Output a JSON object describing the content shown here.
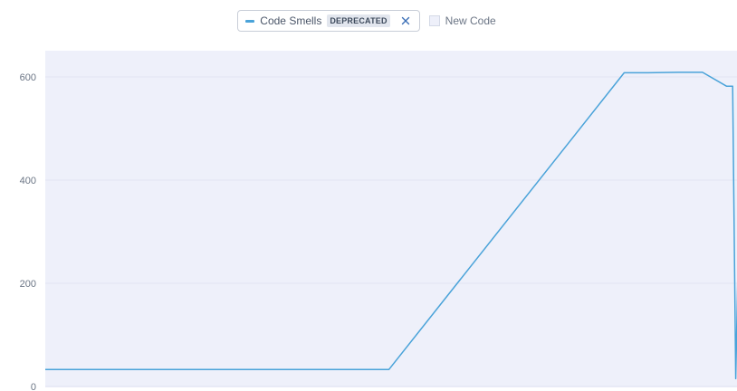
{
  "legend": {
    "series_label": "Code Smells",
    "badge": "DEPRECATED",
    "new_code_label": "New Code"
  },
  "colors": {
    "series_line": "#4aa3d9",
    "plot_background": "#eef0fa",
    "gridline": "#e2e5f2"
  },
  "chart_data": {
    "type": "line",
    "title": "",
    "xlabel": "",
    "ylabel": "",
    "ylim": [
      0,
      600
    ],
    "yticks": [
      0,
      200,
      400,
      600
    ],
    "grid": true,
    "legend_position": "top",
    "series": [
      {
        "name": "Code Smells",
        "x": [
          0,
          0.57,
          0.96,
          1.0,
          1.05,
          1.09,
          1.13,
          1.14,
          1.145,
          1.15,
          1.155,
          1.16,
          1.17,
          1.19,
          1.2
        ],
        "y": [
          33,
          33,
          608,
          608,
          609,
          609,
          582,
          582,
          15,
          305,
          305,
          305,
          180,
          15,
          15
        ]
      }
    ]
  }
}
